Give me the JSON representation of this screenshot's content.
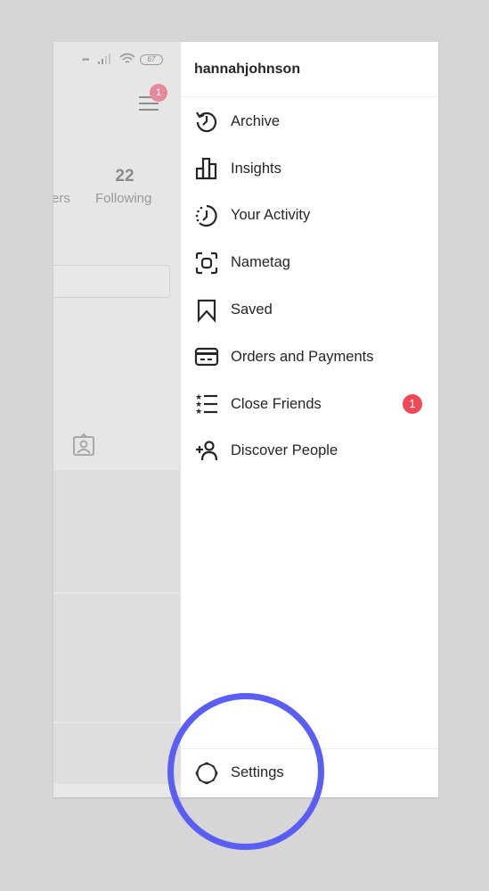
{
  "status_bar": {
    "battery": "67",
    "signal_icon": "cellular-signal-icon",
    "wifi_icon": "wifi-icon"
  },
  "profile_background": {
    "menu_badge_count": "1",
    "stats": [
      {
        "value": "",
        "label": "ers"
      },
      {
        "value": "22",
        "label": "Following"
      }
    ]
  },
  "drawer": {
    "username": "hannahjohnson",
    "items": [
      {
        "label": "Archive",
        "icon": "archive-history-icon"
      },
      {
        "label": "Insights",
        "icon": "insights-bar-chart-icon"
      },
      {
        "label": "Your Activity",
        "icon": "activity-clock-icon"
      },
      {
        "label": "Nametag",
        "icon": "nametag-scan-icon"
      },
      {
        "label": "Saved",
        "icon": "bookmark-icon"
      },
      {
        "label": "Orders and Payments",
        "icon": "credit-card-icon"
      },
      {
        "label": "Close Friends",
        "icon": "close-friends-list-icon",
        "badge": "1"
      },
      {
        "label": "Discover People",
        "icon": "add-person-icon"
      }
    ],
    "settings_label": "Settings"
  },
  "colors": {
    "badge_red": "#ed4956",
    "highlight_ring": "#5b5ef4",
    "dimmed_badge": "#e8899a"
  }
}
